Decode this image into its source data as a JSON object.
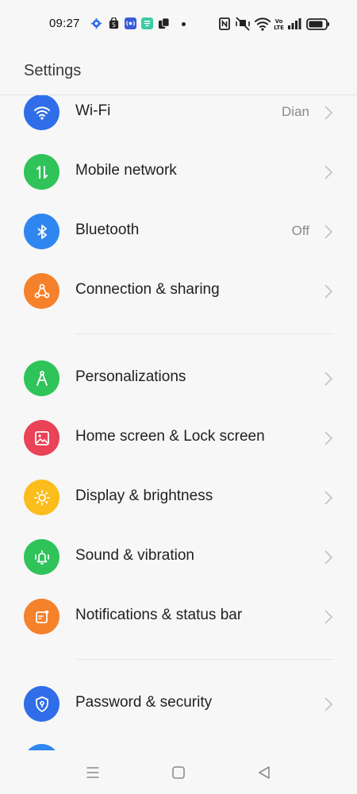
{
  "status_bar": {
    "time": "09:27",
    "left_icons": [
      "gear-icon",
      "shop-bag-icon",
      "radio-icon",
      "app-icon",
      "dual-window-icon"
    ],
    "right_icons": [
      "nfc-icon",
      "mute-vibrate-icon",
      "wifi-icon",
      "volte-icon",
      "signal-icon",
      "battery-icon"
    ]
  },
  "header": {
    "title": "Settings"
  },
  "settings": {
    "items": [
      {
        "label": "Wi-Fi",
        "value": "Dian",
        "icon": "wifi-icon",
        "color": "#2f6ee8"
      },
      {
        "label": "Mobile network",
        "icon": "mobile-data-icon",
        "color": "#2fc35a"
      },
      {
        "label": "Bluetooth",
        "value": "Off",
        "icon": "bluetooth-icon",
        "color": "#2f86f0"
      },
      {
        "label": "Connection & sharing",
        "icon": "connection-sharing-icon",
        "color": "#f5812b"
      },
      {
        "label": "Personalizations",
        "icon": "personalization-icon",
        "color": "#2fc35a"
      },
      {
        "label": "Home screen & Lock screen",
        "icon": "image-icon",
        "color": "#ea4256"
      },
      {
        "label": "Display & brightness",
        "icon": "brightness-icon",
        "color": "#fbbd1c"
      },
      {
        "label": "Sound & vibration",
        "icon": "bell-vibrate-icon",
        "color": "#2fc35a"
      },
      {
        "label": "Notifications & status bar",
        "icon": "notification-icon",
        "color": "#f5812b"
      },
      {
        "label": "Password & security",
        "icon": "shield-key-icon",
        "color": "#2f6ee8"
      }
    ]
  },
  "nav_bar": {
    "buttons": [
      "menu-icon",
      "home-icon",
      "back-icon"
    ]
  },
  "colors": {
    "background": "#f7f7f7",
    "chevron": "#c4c4c4",
    "value_text": "#8a8a8a",
    "next_item_partial": "#2f86f0"
  }
}
